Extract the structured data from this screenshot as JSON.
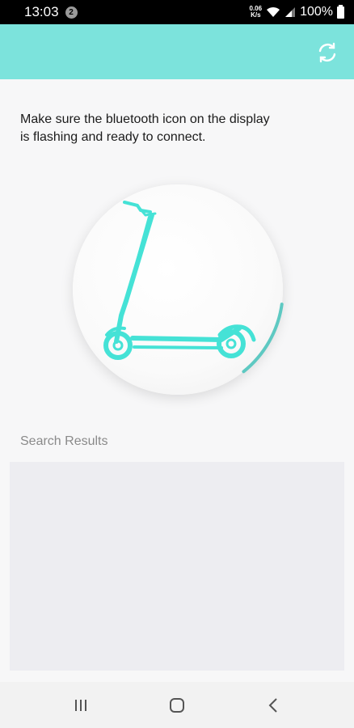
{
  "status_bar": {
    "time": "13:03",
    "notification_count": "2",
    "net_speed_value": "0.06",
    "net_speed_unit": "K/s",
    "battery": "100%"
  },
  "header": {
    "refresh_icon": "refresh-icon"
  },
  "main": {
    "instruction": "Make sure the bluetooth icon on the display\n is flashing and ready to connect.",
    "results_label": "Search Results",
    "search_progress_fraction": 0.12,
    "results": []
  },
  "colors": {
    "accent": "#7ce3dc",
    "scooter": "#45e2d6",
    "progress_arc": "#5ec9c2"
  },
  "nav": {
    "recents_icon": "recents-icon",
    "home_icon": "home-icon",
    "back_icon": "back-icon"
  }
}
